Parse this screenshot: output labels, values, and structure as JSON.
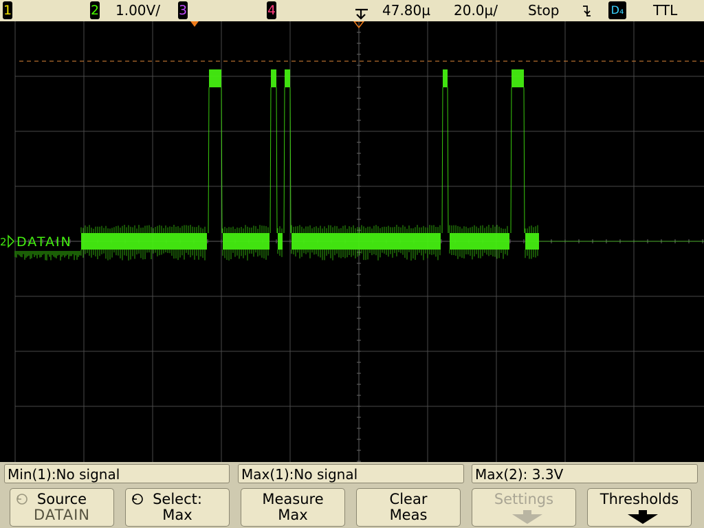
{
  "status_bar": {
    "ch1_label": "1",
    "ch2_label": "2",
    "ch2_scale": "1.00V/",
    "ch3_label": "3",
    "ch4_label": "4",
    "delay": "47.80µ",
    "timebase": "20.0µ/",
    "run_state": "Stop",
    "trigger_source": "D₄",
    "threshold": "TTL"
  },
  "waveform": {
    "channel_marker": "2",
    "label": "DATAIN",
    "trace_color": "#44ee11",
    "reference_line_color": "#e28a3a"
  },
  "measurements": [
    {
      "text": "Min(1):No signal"
    },
    {
      "text": "Max(1):No signal"
    },
    {
      "text": "Max(2): 3.3V"
    }
  ],
  "softkeys": [
    {
      "line1": "Source",
      "line2": "DATAIN",
      "icon": "rotate-knob-icon"
    },
    {
      "line1": "Select:",
      "line2": "Max",
      "icon": "rotate-knob-icon"
    },
    {
      "line1": "Measure",
      "line2": "Max"
    },
    {
      "line1": "Clear",
      "line2": "Meas"
    },
    {
      "line1": "Settings",
      "line2": "",
      "disabled": true
    },
    {
      "line1": "Thresholds",
      "line2": ""
    }
  ]
}
